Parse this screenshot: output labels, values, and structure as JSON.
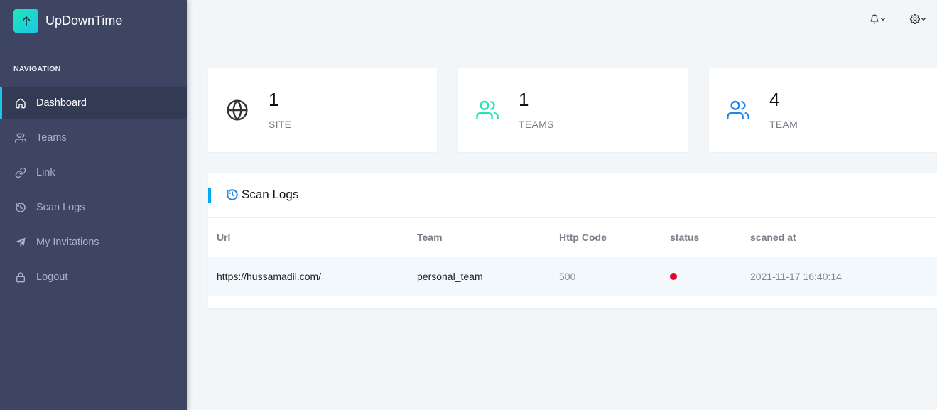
{
  "brand": {
    "name": "UpDownTime",
    "accent_from": "#1de9b6",
    "accent_to": "#1dc4e9"
  },
  "sidebar": {
    "caption": "NAVIGATION",
    "items": [
      {
        "label": "Dashboard",
        "icon": "home-icon",
        "active": true
      },
      {
        "label": "Teams",
        "icon": "users-icon",
        "active": false
      },
      {
        "label": "Link",
        "icon": "link-icon",
        "active": false
      },
      {
        "label": "Scan Logs",
        "icon": "history-icon",
        "active": false
      },
      {
        "label": "My Invitations",
        "icon": "paper-plane-icon",
        "active": false
      },
      {
        "label": "Logout",
        "icon": "lock-icon",
        "active": false
      }
    ]
  },
  "topbar": {
    "icons": [
      "bell-icon",
      "gear-icon"
    ]
  },
  "stats": [
    {
      "value": "1",
      "label": "SITE",
      "icon": "globe-icon",
      "color": "#333333"
    },
    {
      "value": "1",
      "label": "TEAMS",
      "icon": "users-icon",
      "color": "#1de9b6"
    },
    {
      "value": "4",
      "label": "TEAM",
      "icon": "users-icon",
      "color": "#1e88e5"
    }
  ],
  "scan_logs": {
    "title": "Scan Logs",
    "columns": [
      "Url",
      "Team",
      "Http Code",
      "status",
      "scaned at"
    ],
    "rows": [
      {
        "url": "https://hussamadil.com/",
        "team": "personal_team",
        "http_code": "500",
        "status": "down",
        "status_color": "#e8002a",
        "scanned_at": "2021-11-17 16:40:14"
      }
    ]
  }
}
